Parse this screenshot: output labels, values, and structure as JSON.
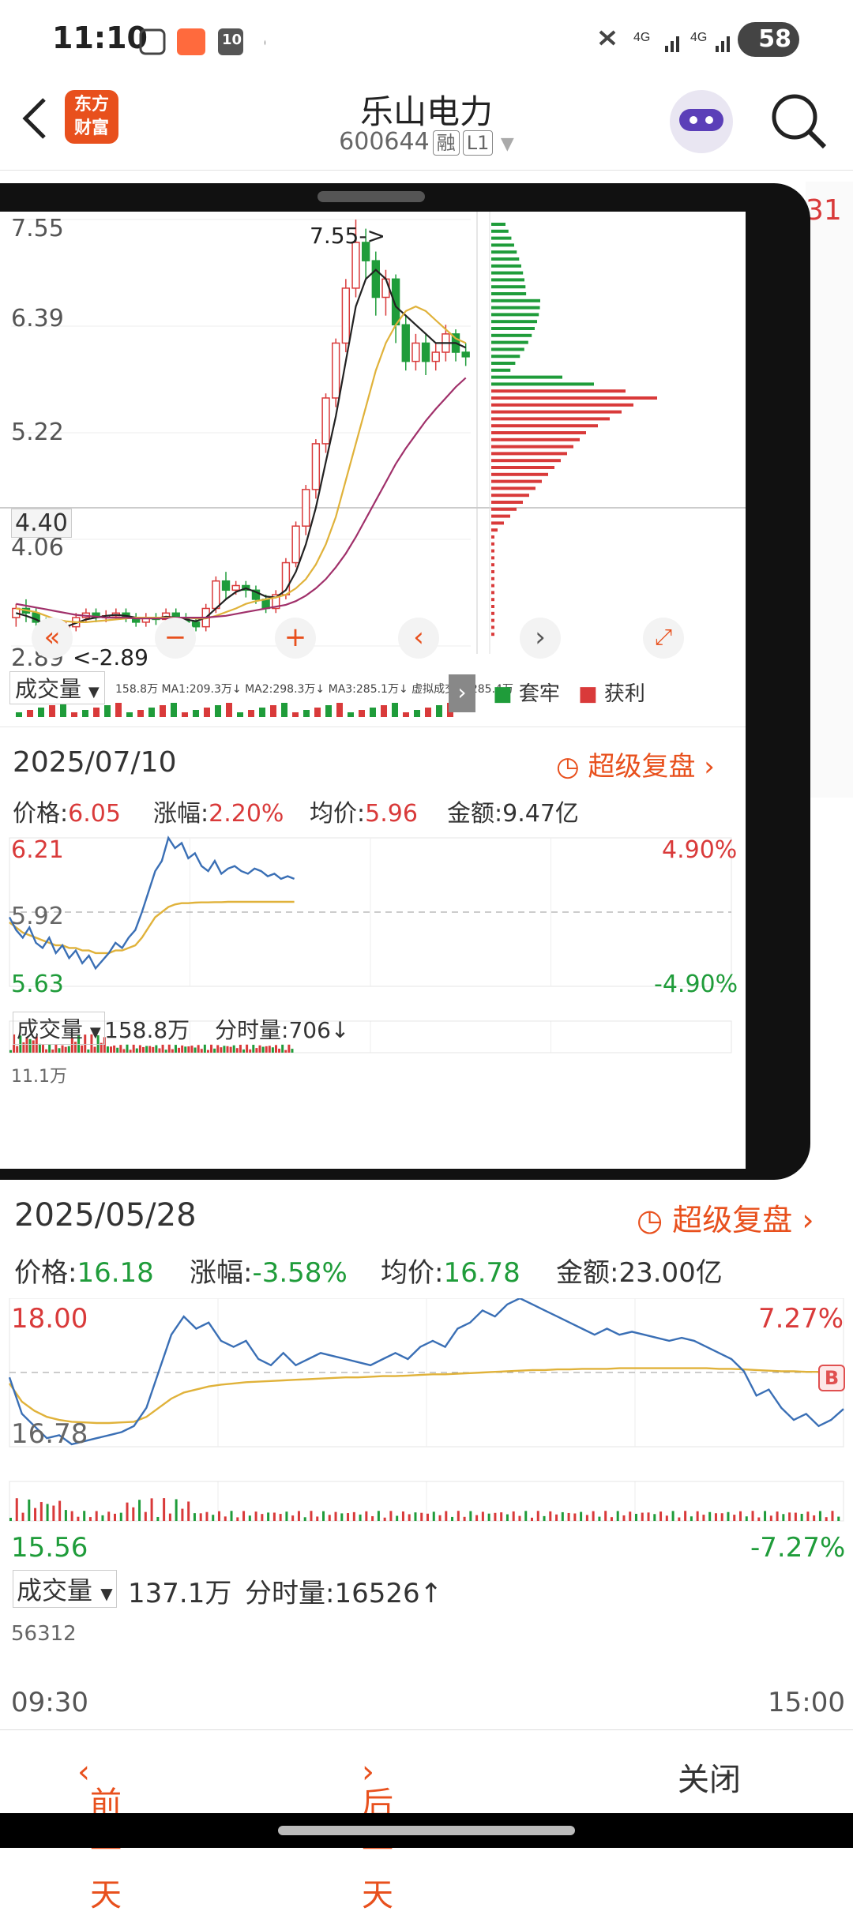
{
  "status": {
    "time": "11:10",
    "battery": "58",
    "calendar_badge": "10"
  },
  "header": {
    "logo_line1": "东方",
    "logo_line2": "财富",
    "title": "乐山电力",
    "code": "600644",
    "tag1": "融",
    "tag2": "L1"
  },
  "kline": {
    "y_labels": [
      "7.55",
      "6.39",
      "5.22",
      "4.06",
      "2.89"
    ],
    "crosshair": "4.40",
    "high_mark": "7.55->",
    "low_mark": "<-2.89",
    "volume_label": "成交量",
    "volume_stats": "158.8万 MA1:209.3万↓ MA2:298.3万↓ MA3:285.1万↓ 虚拟成交量:285.4万",
    "legend_trapped": "套牢",
    "legend_profit": "获利",
    "watermark": "东方财富",
    "candles": [
      {
        "o": 3.2,
        "c": 3.3,
        "h": 3.35,
        "l": 3.1
      },
      {
        "o": 3.3,
        "c": 3.25,
        "h": 3.4,
        "l": 3.15
      },
      {
        "o": 3.25,
        "c": 3.15,
        "h": 3.3,
        "l": 3.05
      },
      {
        "o": 3.15,
        "c": 3.1,
        "h": 3.2,
        "l": 2.95
      },
      {
        "o": 3.1,
        "c": 3.0,
        "h": 3.15,
        "l": 2.89
      },
      {
        "o": 3.0,
        "c": 3.1,
        "h": 3.15,
        "l": 2.95
      },
      {
        "o": 3.1,
        "c": 3.2,
        "h": 3.25,
        "l": 3.05
      },
      {
        "o": 3.2,
        "c": 3.25,
        "h": 3.3,
        "l": 3.15
      },
      {
        "o": 3.25,
        "c": 3.2,
        "h": 3.3,
        "l": 3.15
      },
      {
        "o": 3.2,
        "c": 3.22,
        "h": 3.28,
        "l": 3.15
      },
      {
        "o": 3.22,
        "c": 3.25,
        "h": 3.3,
        "l": 3.18
      },
      {
        "o": 3.25,
        "c": 3.2,
        "h": 3.3,
        "l": 3.15
      },
      {
        "o": 3.2,
        "c": 3.15,
        "h": 3.25,
        "l": 3.1
      },
      {
        "o": 3.15,
        "c": 3.2,
        "h": 3.25,
        "l": 3.1
      },
      {
        "o": 3.2,
        "c": 3.18,
        "h": 3.25,
        "l": 3.12
      },
      {
        "o": 3.18,
        "c": 3.25,
        "h": 3.3,
        "l": 3.12
      },
      {
        "o": 3.25,
        "c": 3.2,
        "h": 3.3,
        "l": 3.15
      },
      {
        "o": 3.2,
        "c": 3.15,
        "h": 3.25,
        "l": 3.1
      },
      {
        "o": 3.15,
        "c": 3.1,
        "h": 3.2,
        "l": 3.05
      },
      {
        "o": 3.1,
        "c": 3.3,
        "h": 3.35,
        "l": 3.05
      },
      {
        "o": 3.3,
        "c": 3.6,
        "h": 3.65,
        "l": 3.25
      },
      {
        "o": 3.6,
        "c": 3.5,
        "h": 3.7,
        "l": 3.4
      },
      {
        "o": 3.5,
        "c": 3.55,
        "h": 3.6,
        "l": 3.45
      },
      {
        "o": 3.55,
        "c": 3.5,
        "h": 3.6,
        "l": 3.42
      },
      {
        "o": 3.5,
        "c": 3.4,
        "h": 3.55,
        "l": 3.35
      },
      {
        "o": 3.4,
        "c": 3.3,
        "h": 3.45,
        "l": 3.25
      },
      {
        "o": 3.3,
        "c": 3.45,
        "h": 3.5,
        "l": 3.25
      },
      {
        "o": 3.45,
        "c": 3.8,
        "h": 3.85,
        "l": 3.4
      },
      {
        "o": 3.8,
        "c": 4.2,
        "h": 4.25,
        "l": 3.75
      },
      {
        "o": 4.2,
        "c": 4.6,
        "h": 4.65,
        "l": 4.1
      },
      {
        "o": 4.6,
        "c": 5.1,
        "h": 5.15,
        "l": 4.5
      },
      {
        "o": 5.1,
        "c": 5.6,
        "h": 5.65,
        "l": 5.0
      },
      {
        "o": 5.6,
        "c": 6.2,
        "h": 6.25,
        "l": 5.5
      },
      {
        "o": 6.2,
        "c": 6.8,
        "h": 6.9,
        "l": 6.1
      },
      {
        "o": 6.8,
        "c": 7.3,
        "h": 7.55,
        "l": 6.7
      },
      {
        "o": 7.3,
        "c": 7.1,
        "h": 7.45,
        "l": 6.9
      },
      {
        "o": 7.1,
        "c": 6.7,
        "h": 7.2,
        "l": 6.5
      },
      {
        "o": 6.7,
        "c": 6.9,
        "h": 7.0,
        "l": 6.5
      },
      {
        "o": 6.9,
        "c": 6.4,
        "h": 6.95,
        "l": 6.2
      },
      {
        "o": 6.4,
        "c": 6.0,
        "h": 6.5,
        "l": 5.9
      },
      {
        "o": 6.0,
        "c": 6.2,
        "h": 6.3,
        "l": 5.9
      },
      {
        "o": 6.2,
        "c": 6.0,
        "h": 6.3,
        "l": 5.85
      },
      {
        "o": 6.0,
        "c": 6.1,
        "h": 6.2,
        "l": 5.9
      },
      {
        "o": 6.1,
        "c": 6.3,
        "h": 6.4,
        "l": 6.0
      },
      {
        "o": 6.3,
        "c": 6.1,
        "h": 6.35,
        "l": 6.0
      },
      {
        "o": 6.1,
        "c": 6.05,
        "h": 6.2,
        "l": 5.95
      }
    ],
    "ma5": [
      3.25,
      3.22,
      3.18,
      3.12,
      3.08,
      3.1,
      3.14,
      3.18,
      3.2,
      3.22,
      3.23,
      3.22,
      3.2,
      3.2,
      3.19,
      3.21,
      3.2,
      3.18,
      3.16,
      3.2,
      3.3,
      3.4,
      3.48,
      3.52,
      3.48,
      3.43,
      3.42,
      3.5,
      3.7,
      4.0,
      4.4,
      4.9,
      5.4,
      6.0,
      6.6,
      6.9,
      7.0,
      6.9,
      6.6,
      6.5,
      6.4,
      6.3,
      6.2,
      6.2,
      6.2,
      6.15
    ],
    "ma10": [
      3.3,
      3.28,
      3.26,
      3.22,
      3.18,
      3.16,
      3.15,
      3.15,
      3.16,
      3.17,
      3.18,
      3.19,
      3.2,
      3.2,
      3.2,
      3.2,
      3.2,
      3.2,
      3.19,
      3.19,
      3.22,
      3.26,
      3.3,
      3.35,
      3.38,
      3.4,
      3.42,
      3.45,
      3.52,
      3.62,
      3.78,
      4.0,
      4.3,
      4.7,
      5.1,
      5.5,
      5.9,
      6.2,
      6.4,
      6.55,
      6.6,
      6.55,
      6.45,
      6.35,
      6.25,
      6.2
    ],
    "ma20": [
      3.35,
      3.33,
      3.31,
      3.29,
      3.27,
      3.25,
      3.23,
      3.22,
      3.21,
      3.2,
      3.2,
      3.2,
      3.19,
      3.19,
      3.19,
      3.19,
      3.2,
      3.2,
      3.2,
      3.2,
      3.21,
      3.22,
      3.24,
      3.26,
      3.28,
      3.3,
      3.32,
      3.34,
      3.38,
      3.44,
      3.52,
      3.62,
      3.75,
      3.9,
      4.08,
      4.28,
      4.48,
      4.68,
      4.88,
      5.05,
      5.2,
      5.35,
      5.48,
      5.6,
      5.72,
      5.82
    ]
  },
  "intraday1": {
    "date": "2025/07/10",
    "replay": "超级复盘",
    "price_label": "价格:",
    "price": "6.05",
    "change_label": "涨幅:",
    "change": "2.20%",
    "avg_label": "均价:",
    "avg": "5.96",
    "amount_label": "金额:",
    "amount": "9.47亿",
    "y_top": "6.21",
    "y_mid": "5.92",
    "y_bottom": "5.63",
    "pct_top": "4.90%",
    "pct_bottom": "-4.90%",
    "volume_label": "成交量",
    "volume": "158.8万",
    "tick_label": "分时量:",
    "tick": "706↓",
    "vol_max": "11.1万",
    "price_series": [
      5.9,
      5.85,
      5.82,
      5.86,
      5.8,
      5.78,
      5.82,
      5.76,
      5.79,
      5.74,
      5.77,
      5.72,
      5.75,
      5.7,
      5.73,
      5.76,
      5.8,
      5.78,
      5.82,
      5.85,
      5.92,
      6.0,
      6.08,
      6.12,
      6.21,
      6.17,
      6.19,
      6.13,
      6.15,
      6.1,
      6.08,
      6.12,
      6.07,
      6.09,
      6.1,
      6.08,
      6.07,
      6.09,
      6.08,
      6.06,
      6.07,
      6.05,
      6.06,
      6.05
    ],
    "avg_series": [
      5.88,
      5.86,
      5.84,
      5.83,
      5.82,
      5.81,
      5.8,
      5.79,
      5.79,
      5.78,
      5.78,
      5.77,
      5.77,
      5.76,
      5.76,
      5.76,
      5.77,
      5.77,
      5.78,
      5.79,
      5.82,
      5.86,
      5.9,
      5.92,
      5.94,
      5.95,
      5.955,
      5.955,
      5.957,
      5.958,
      5.958,
      5.959,
      5.959,
      5.96,
      5.96,
      5.96,
      5.96,
      5.96,
      5.96,
      5.96,
      5.96,
      5.96,
      5.96,
      5.96
    ]
  },
  "intraday2": {
    "date": "2025/05/28",
    "replay": "超级复盘",
    "price_label": "价格:",
    "price": "16.18",
    "change_label": "涨幅:",
    "change": "-3.58%",
    "avg_label": "均价:",
    "avg": "16.78",
    "amount_label": "金额:",
    "amount": "23.00亿",
    "y_top": "18.00",
    "y_mid": "16.78",
    "y_bottom": "15.56",
    "pct_top": "7.27%",
    "pct_bottom": "-7.27%",
    "marker_b": "B",
    "volume_label": "成交量",
    "volume": "137.1万",
    "tick_label": "分时量:",
    "tick": "16526↑",
    "vol_max": "56312",
    "time_start": "09:30",
    "time_end": "15:00",
    "price_series": [
      16.7,
      16.1,
      15.9,
      15.7,
      15.75,
      15.6,
      15.65,
      15.7,
      15.75,
      15.8,
      15.9,
      16.2,
      16.8,
      17.4,
      17.7,
      17.5,
      17.6,
      17.3,
      17.2,
      17.3,
      17.0,
      16.9,
      17.1,
      16.9,
      17.0,
      17.1,
      17.05,
      17.0,
      16.95,
      16.9,
      17.0,
      17.1,
      17.0,
      17.2,
      17.3,
      17.2,
      17.5,
      17.6,
      17.8,
      17.7,
      17.9,
      18.0,
      17.9,
      17.8,
      17.7,
      17.6,
      17.5,
      17.4,
      17.5,
      17.4,
      17.45,
      17.4,
      17.35,
      17.3,
      17.35,
      17.3,
      17.2,
      17.1,
      17.0,
      16.8,
      16.4,
      16.5,
      16.2,
      16.0,
      16.1,
      15.9,
      16.0,
      16.18
    ],
    "avg_series": [
      16.6,
      16.3,
      16.15,
      16.05,
      16.0,
      15.97,
      15.96,
      15.95,
      15.95,
      15.96,
      15.97,
      16.05,
      16.2,
      16.35,
      16.45,
      16.5,
      16.55,
      16.58,
      16.6,
      16.62,
      16.63,
      16.64,
      16.65,
      16.66,
      16.67,
      16.68,
      16.69,
      16.7,
      16.7,
      16.71,
      16.72,
      16.72,
      16.73,
      16.74,
      16.75,
      16.75,
      16.76,
      16.77,
      16.78,
      16.79,
      16.8,
      16.81,
      16.82,
      16.82,
      16.83,
      16.83,
      16.84,
      16.84,
      16.84,
      16.85,
      16.85,
      16.85,
      16.85,
      16.85,
      16.85,
      16.85,
      16.85,
      16.84,
      16.84,
      16.83,
      16.82,
      16.81,
      16.8,
      16.8,
      16.79,
      16.79,
      16.78,
      16.78
    ]
  },
  "footer": {
    "prev": "前一天",
    "next": "后一天",
    "close": "关闭"
  },
  "colors": {
    "up": "#d93a3a",
    "down": "#1f9c3a",
    "orange": "#e8501d",
    "line_blue": "#3a6fb5",
    "avg_yellow": "#e0b23a",
    "ma10": "#222222",
    "ma20": "#a0306a"
  }
}
